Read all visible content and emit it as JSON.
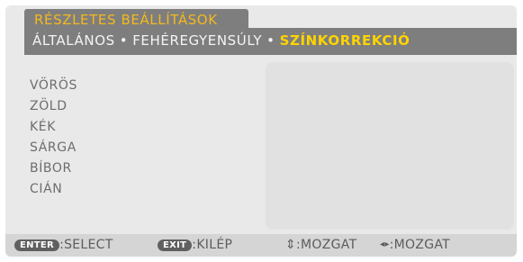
{
  "window": {
    "title": "RÉSZLETES BEÁLLÍTÁSOK"
  },
  "tabs": [
    {
      "label": "ÁLTALÁNOS",
      "active": false
    },
    {
      "label": "FEHÉREGYENSÚLY",
      "active": false
    },
    {
      "label": "SZÍNKORREKCIÓ",
      "active": true
    }
  ],
  "tab_separator": "•",
  "menu_items": [
    {
      "label": "VÖRÖS"
    },
    {
      "label": "ZÖLD"
    },
    {
      "label": "KÉK"
    },
    {
      "label": "SÁRGA"
    },
    {
      "label": "BÍBOR"
    },
    {
      "label": "CIÁN"
    }
  ],
  "footer": {
    "enter_key": "ENTER",
    "enter_label": ":SELECT",
    "exit_key": "EXIT",
    "exit_label": ":KILÉP",
    "updown_icon": "⇕",
    "updown_label": ":MOZGAT",
    "leftright_icon": "◂▸",
    "leftright_label": ":MOZGAT"
  },
  "colors": {
    "title_text": "#f4b91d",
    "active_tab": "#ffd400",
    "tab_bar": "#7e7e7e",
    "body_bg": "#e9e9e9",
    "menu_text": "#6d6d6d"
  }
}
